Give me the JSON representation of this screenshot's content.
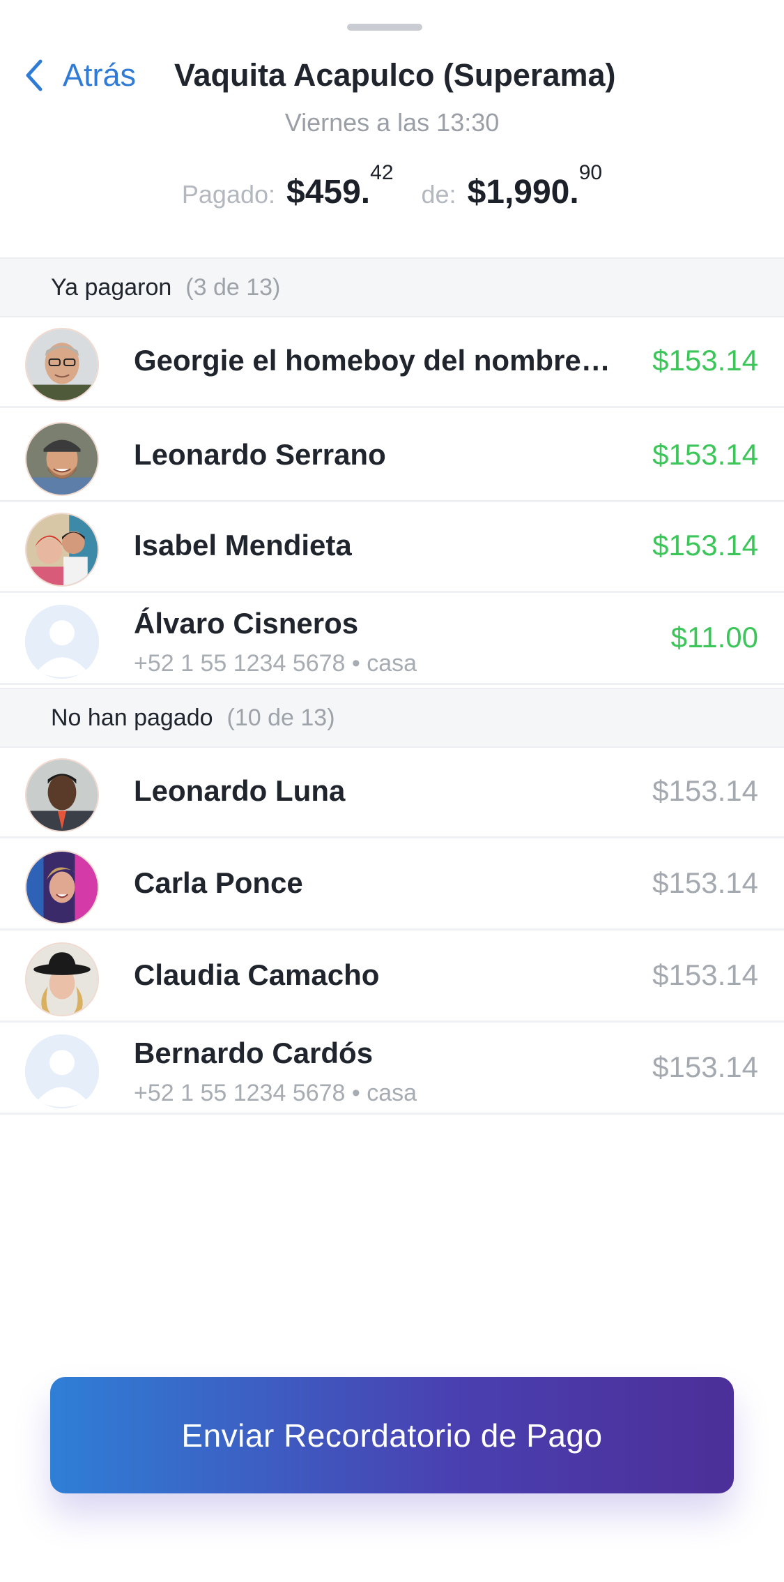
{
  "nav": {
    "back_label": "Atrás",
    "title": "Vaquita Acapulco (Superama)"
  },
  "subtitle": "Viernes a las 13:30",
  "totals": {
    "paid_label": "Pagado:",
    "paid_amount": "$459.",
    "paid_cents": "42",
    "of_label": "de:",
    "total_amount": "$1,990.",
    "total_cents": "90"
  },
  "paid_section": {
    "title": "Ya pagaron",
    "count": "(3 de 13)",
    "rows": [
      {
        "name": "Georgie el homeboy del nombre…",
        "amount": "$153.14",
        "avatar": "man-glasses"
      },
      {
        "name": "Leonardo Serrano",
        "amount": "$153.14",
        "avatar": "man-cap"
      },
      {
        "name": "Isabel Mendieta",
        "amount": "$153.14",
        "avatar": "couple"
      },
      {
        "name": "Álvaro Cisneros",
        "sub": "+52 1 55 1234 5678 • casa",
        "amount": "$11.00",
        "avatar": "placeholder"
      }
    ]
  },
  "unpaid_section": {
    "title": "No han pagado",
    "count": "(10 de 13)",
    "rows": [
      {
        "name": "Leonardo Luna",
        "amount": "$153.14",
        "avatar": "man-suit"
      },
      {
        "name": "Carla Ponce",
        "amount": "$153.14",
        "avatar": "woman-neon"
      },
      {
        "name": "Claudia Camacho",
        "amount": "$153.14",
        "avatar": "woman-hat"
      },
      {
        "name": "Bernardo Cardós",
        "sub": "+52 1 55 1234 5678 • casa",
        "amount": "$153.14",
        "avatar": "placeholder"
      }
    ]
  },
  "cta": {
    "label": "Enviar Recordatorio de Pago"
  },
  "colors": {
    "accent": "#2f7bd6",
    "paid": "#3cc65a",
    "unpaid": "#a4a8af"
  }
}
